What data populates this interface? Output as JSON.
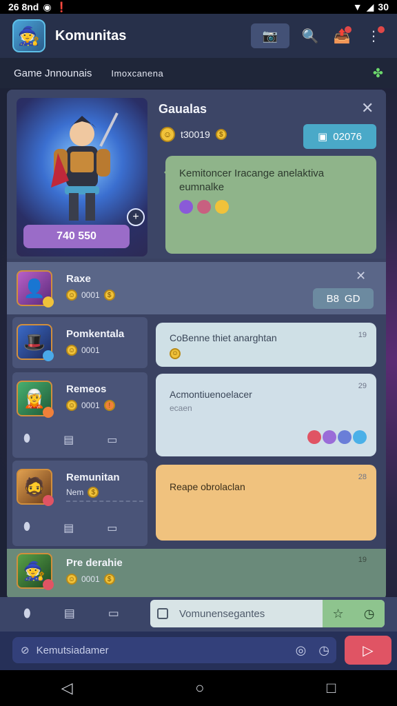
{
  "status": {
    "time": "26 8nd",
    "right": "30",
    "brand": "◉"
  },
  "app": {
    "title": "Komunitas",
    "avatar_icon": "warrior-avatar-icon"
  },
  "subbar": {
    "tab1": "Game Jnnounais",
    "tab2": "Imoxcanena"
  },
  "hero": {
    "title": "Gaualas",
    "stat": "t30019",
    "pill": "02076",
    "price": "740 550",
    "message": "Kemitoncer Iracange anelaktiva eumnalke"
  },
  "rows": [
    {
      "name": "Raxe",
      "meta": "0001",
      "tag": "GD",
      "tag_prefix": "B8"
    },
    {
      "name": "Pomkentala",
      "meta": "0001",
      "bubble": "CoBenne thiet anarghtan",
      "corner": "19"
    },
    {
      "name": "Remeos",
      "meta": "0001",
      "bubble": "Acmontiuenoelacer",
      "bubble_sub": "ecaen",
      "corner": "29"
    },
    {
      "name": "Remunitan",
      "meta": "Nem",
      "bubble": "Reape obrolaclan",
      "corner": "28"
    },
    {
      "name": "Pre derahie",
      "meta": "0001",
      "corner": "19"
    }
  ],
  "composer": {
    "placeholder": "Vomunensegantes"
  },
  "search": {
    "placeholder": "Kemutsiadamer"
  },
  "colors": {
    "accent": "#e05464",
    "panel": "#3a4262",
    "green": "#8fb48a",
    "peach": "#f0c27e"
  }
}
